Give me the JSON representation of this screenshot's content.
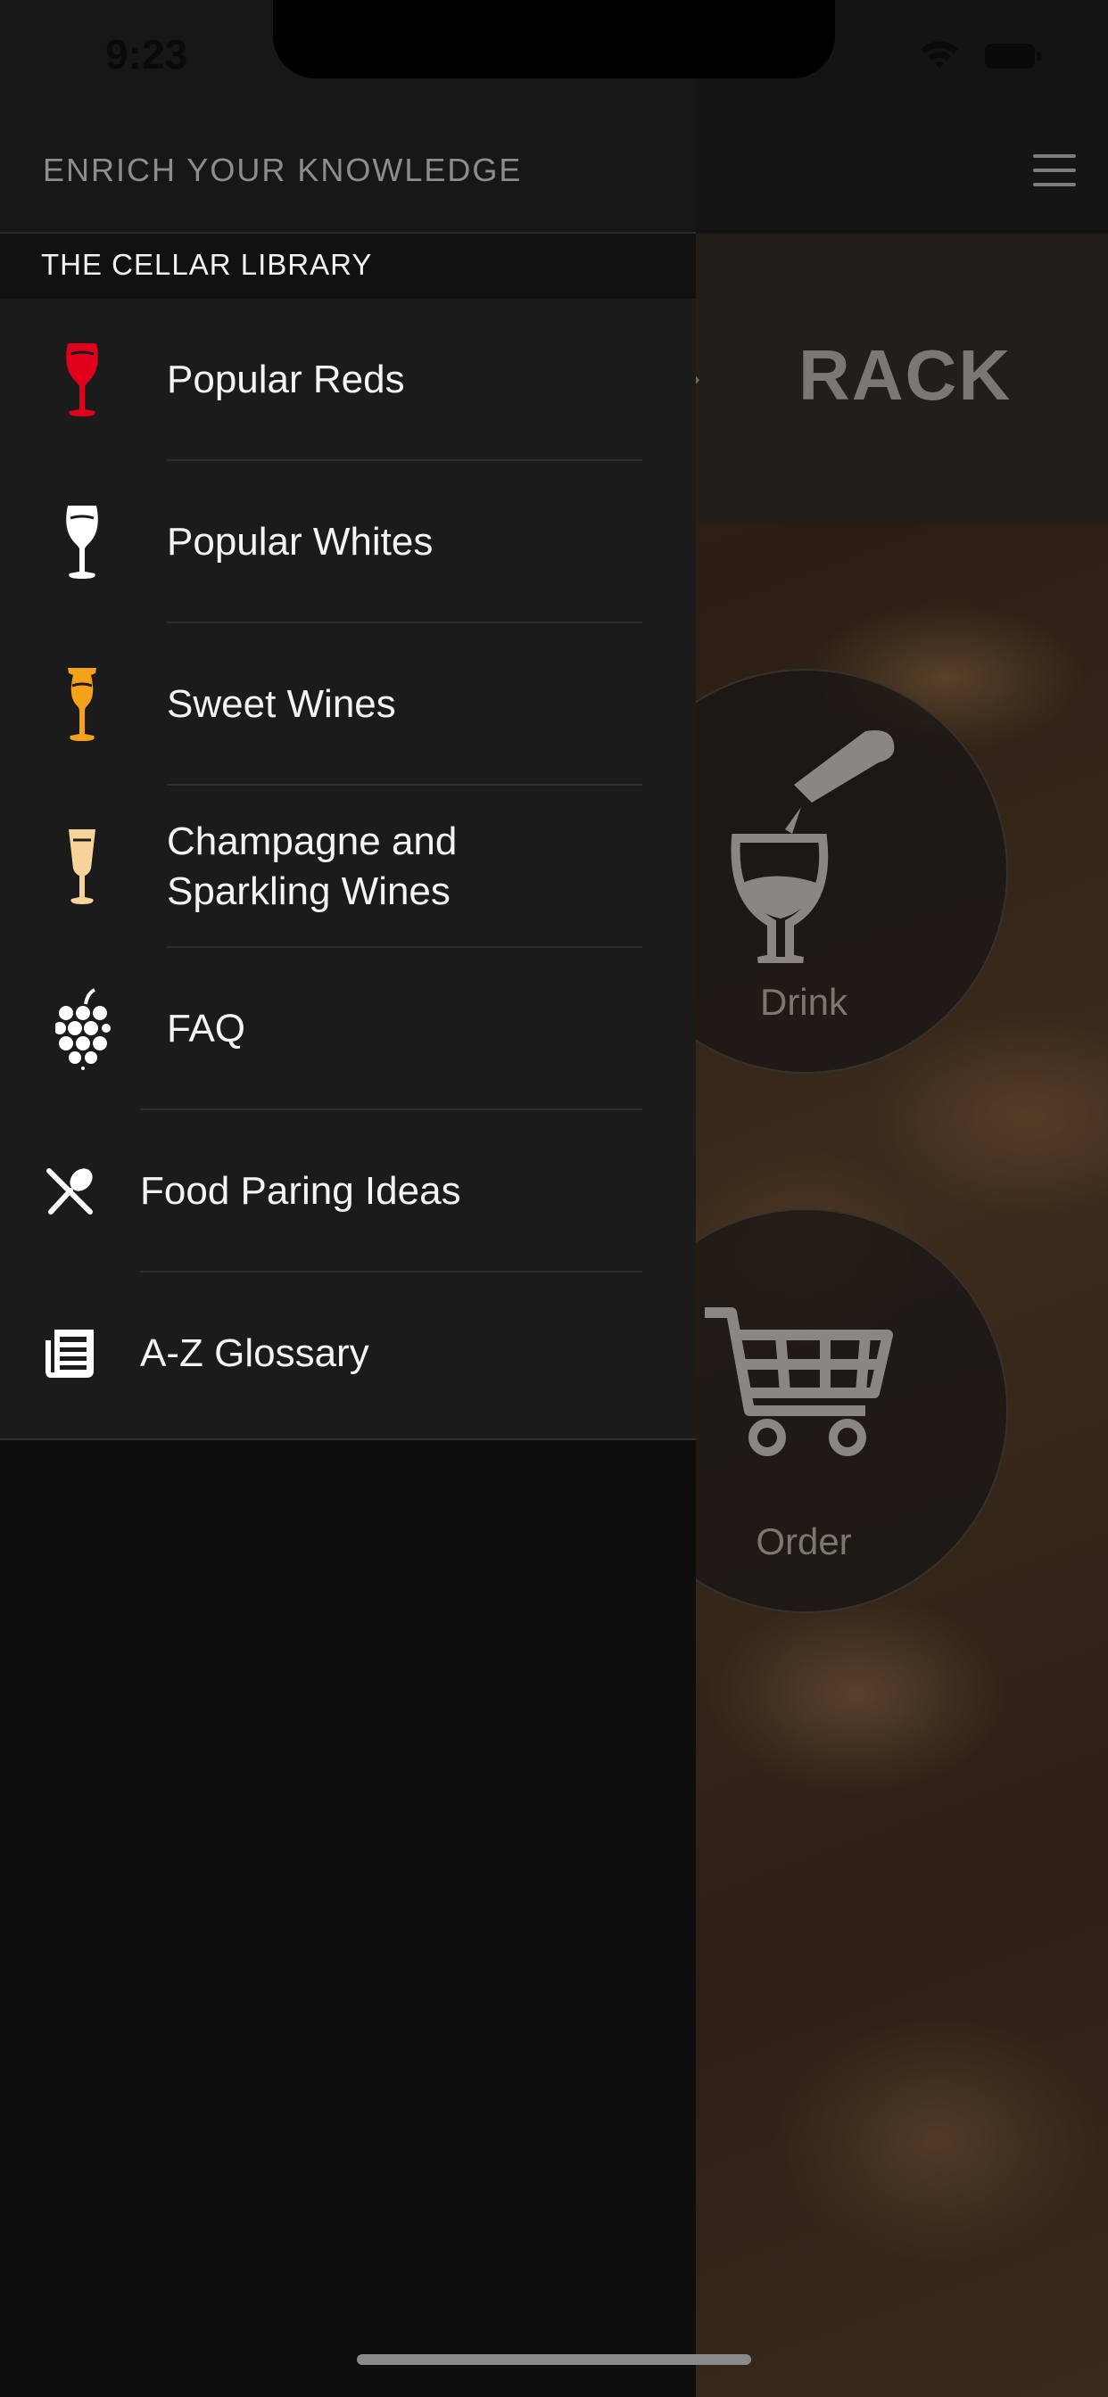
{
  "status_bar": {
    "time": "9:23",
    "icons": [
      "wifi-icon",
      "battery-icon"
    ]
  },
  "drawer": {
    "header_title": "ENRICH YOUR KNOWLEDGE",
    "section_title": "THE CELLAR LIBRARY",
    "items": [
      {
        "label": "Popular Reds",
        "icon": "red-wine-glass-icon",
        "color": "#e0001b"
      },
      {
        "label": "Popular Whites",
        "icon": "white-wine-glass-icon",
        "color": "#ffffff"
      },
      {
        "label": "Sweet Wines",
        "icon": "sweet-wine-glass-icon",
        "color": "#f5a21b"
      },
      {
        "label": "Champagne and\nSparkling Wines",
        "icon": "champagne-flute-icon",
        "color": "#f6d49b"
      },
      {
        "label": "FAQ",
        "icon": "grapes-icon",
        "color": "#ffffff"
      },
      {
        "label": "Food Paring Ideas",
        "icon": "fork-spoon-icon",
        "color": "#ffffff"
      },
      {
        "label": "A-Z Glossary",
        "icon": "newspaper-icon",
        "color": "#ffffff"
      }
    ]
  },
  "background_app": {
    "menu_icon": "hamburger-menu-icon",
    "banner_title": "RACK",
    "buttons": [
      {
        "label": "Drink",
        "icon": "pouring-wine-icon"
      },
      {
        "label": "Order",
        "icon": "shopping-cart-icon"
      }
    ]
  }
}
